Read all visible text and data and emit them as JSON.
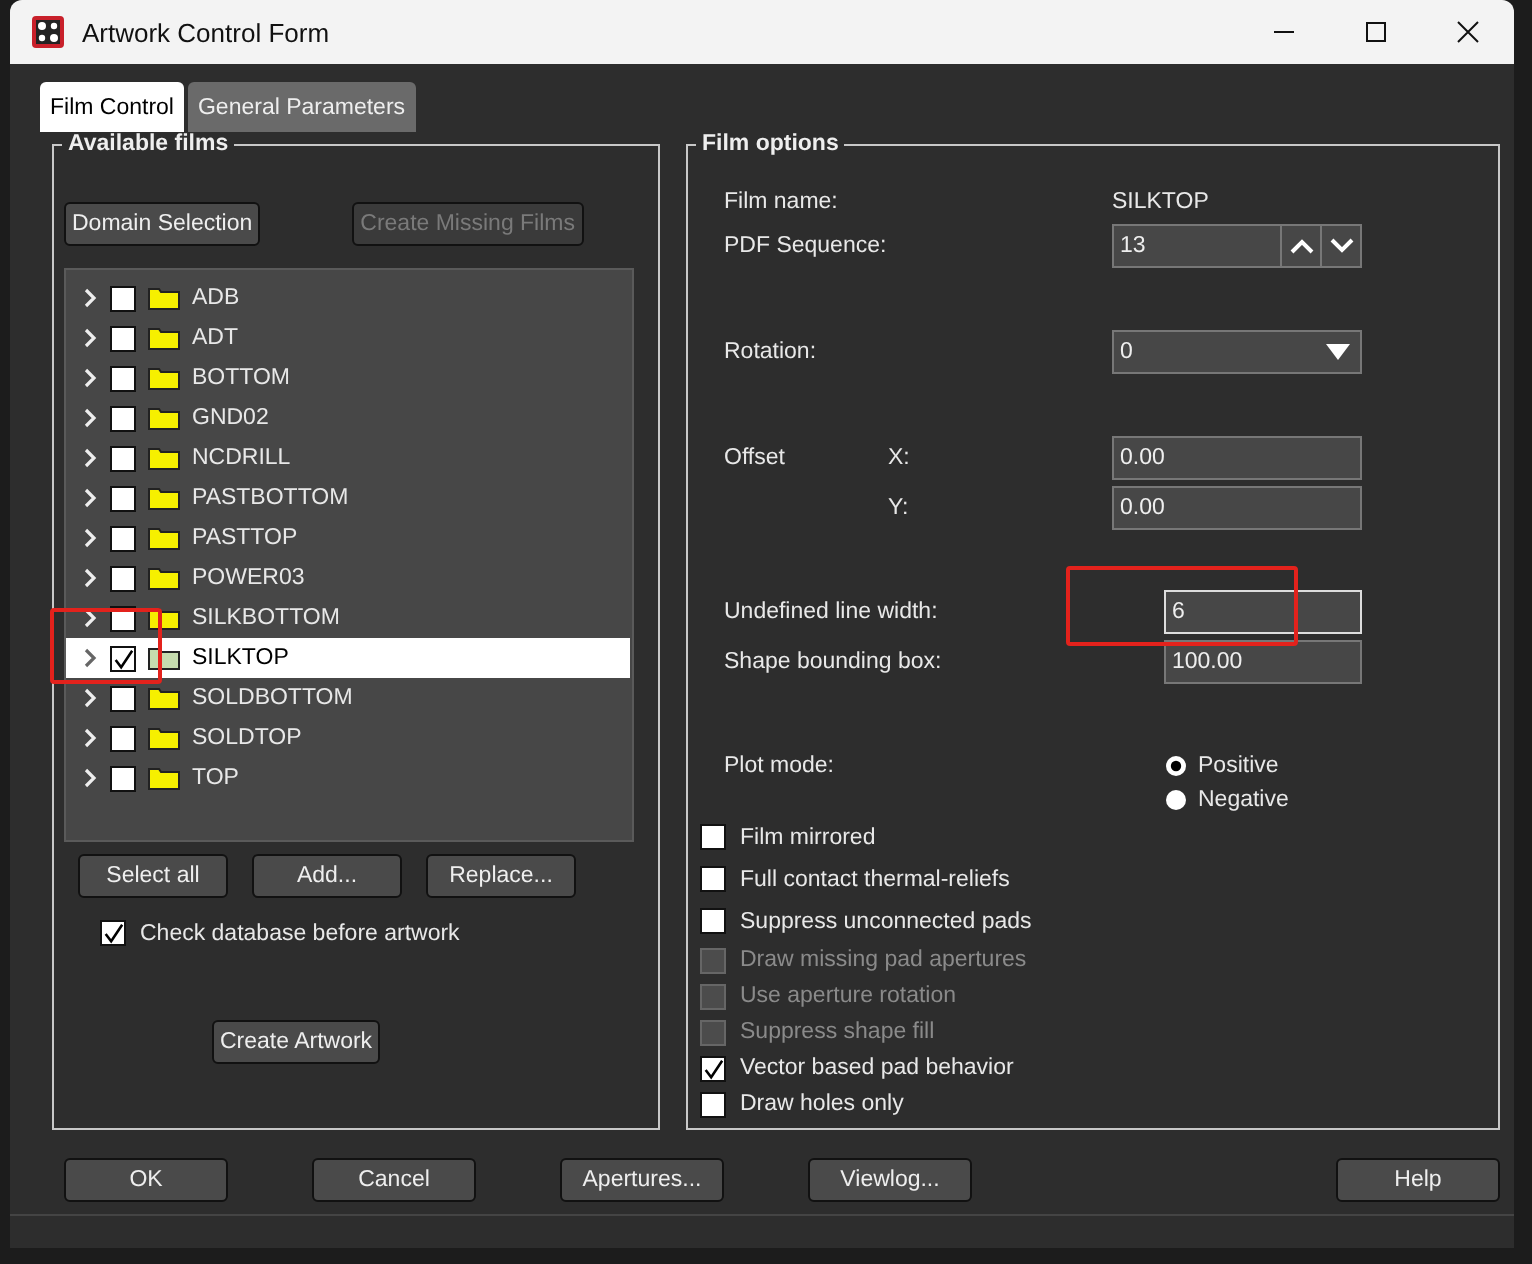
{
  "window": {
    "title": "Artwork Control Form"
  },
  "tabs": [
    {
      "label": "Film Control",
      "selected": true
    },
    {
      "label": "General Parameters",
      "selected": false
    }
  ],
  "available_films": {
    "title": "Available films",
    "top_buttons": [
      {
        "label": "Domain Selection",
        "disabled": false
      },
      {
        "label": "Create Missing Films",
        "disabled": true
      }
    ],
    "films": [
      {
        "name": "ADB",
        "checked": false,
        "selected": false,
        "expanded": false
      },
      {
        "name": "ADT",
        "checked": false,
        "selected": false,
        "expanded": false
      },
      {
        "name": "BOTTOM",
        "checked": false,
        "selected": false,
        "expanded": false
      },
      {
        "name": "GND02",
        "checked": false,
        "selected": false,
        "expanded": false
      },
      {
        "name": "NCDRILL",
        "checked": false,
        "selected": false,
        "expanded": false
      },
      {
        "name": "PASTBOTTOM",
        "checked": false,
        "selected": false,
        "expanded": false
      },
      {
        "name": "PASTTOP",
        "checked": false,
        "selected": false,
        "expanded": false
      },
      {
        "name": "POWER03",
        "checked": false,
        "selected": false,
        "expanded": false
      },
      {
        "name": "SILKBOTTOM",
        "checked": false,
        "selected": false,
        "expanded": false
      },
      {
        "name": "SILKTOP",
        "checked": true,
        "selected": true,
        "expanded": false
      },
      {
        "name": "SOLDBOTTOM",
        "checked": false,
        "selected": false,
        "expanded": false
      },
      {
        "name": "SOLDTOP",
        "checked": false,
        "selected": false,
        "expanded": false
      },
      {
        "name": "TOP",
        "checked": false,
        "selected": false,
        "expanded": false
      }
    ],
    "list_buttons": [
      "Select all",
      "Add...",
      "Replace..."
    ],
    "check_database": {
      "label": "Check database before artwork",
      "checked": true
    },
    "create_button": "Create Artwork"
  },
  "film_options": {
    "title": "Film options",
    "film_name": {
      "label": "Film name:",
      "value": "SILKTOP"
    },
    "pdf_sequence": {
      "label": "PDF Sequence:",
      "value": "13"
    },
    "rotation": {
      "label": "Rotation:",
      "value": "0"
    },
    "offset": {
      "label": "Offset",
      "x_label": "X:",
      "x_value": "0.00",
      "y_label": "Y:",
      "y_value": "0.00"
    },
    "undefined_line_width": {
      "label": "Undefined line width:",
      "value": "6"
    },
    "shape_bounding_box": {
      "label": "Shape bounding box:",
      "value": "100.00"
    },
    "plot_mode": {
      "label": "Plot mode:",
      "options": [
        {
          "label": "Positive",
          "selected": true
        },
        {
          "label": "Negative",
          "selected": false
        }
      ]
    },
    "options": [
      {
        "label": "Film mirrored",
        "checked": false,
        "disabled": false
      },
      {
        "label": "Full contact thermal-reliefs",
        "checked": false,
        "disabled": false
      },
      {
        "label": "Suppress unconnected pads",
        "checked": false,
        "disabled": false
      },
      {
        "label": "Draw missing pad apertures",
        "checked": false,
        "disabled": true
      },
      {
        "label": "Use aperture rotation",
        "checked": false,
        "disabled": true
      },
      {
        "label": "Suppress shape fill",
        "checked": false,
        "disabled": true
      },
      {
        "label": "Vector based pad behavior",
        "checked": true,
        "disabled": false
      },
      {
        "label": "Draw holes only",
        "checked": false,
        "disabled": false
      }
    ]
  },
  "buttons": [
    "OK",
    "Cancel",
    "Apertures...",
    "Viewlog...",
    "Help"
  ]
}
